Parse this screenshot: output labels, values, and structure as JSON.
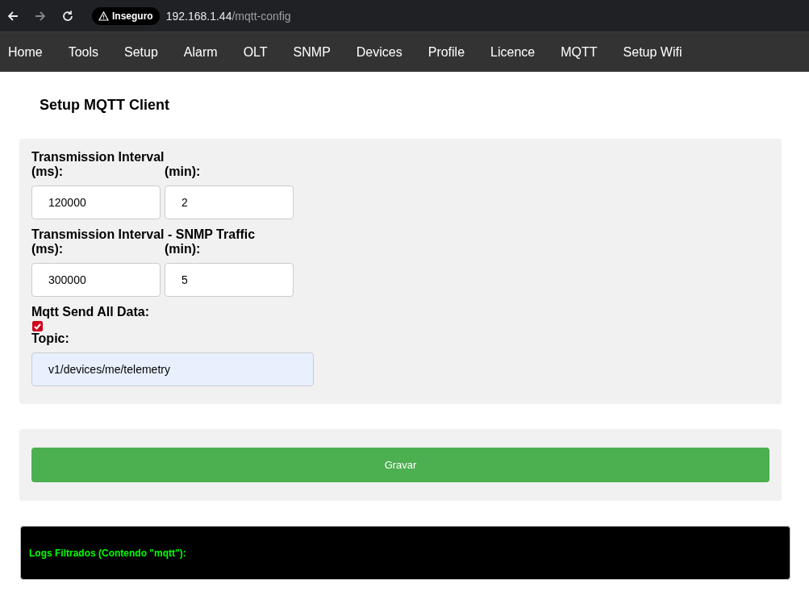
{
  "browser": {
    "security": "Inseguro",
    "url_host": "192.168.1.44",
    "url_path": "/mqtt-config"
  },
  "nav": [
    {
      "label": "Home"
    },
    {
      "label": "Tools"
    },
    {
      "label": "Setup"
    },
    {
      "label": "Alarm"
    },
    {
      "label": "OLT"
    },
    {
      "label": "SNMP"
    },
    {
      "label": "Devices"
    },
    {
      "label": "Profile"
    },
    {
      "label": "Licence"
    },
    {
      "label": "MQTT"
    },
    {
      "label": "Setup Wifi"
    }
  ],
  "title": "Setup MQTT Client",
  "interval_groups": [
    {
      "title": "Transmission Interval",
      "fields": [
        {
          "label": "(ms):",
          "value": "120000"
        },
        {
          "label": "(min):",
          "value": "2"
        }
      ]
    },
    {
      "title": "Transmission Interval - SNMP Traffic",
      "fields": [
        {
          "label": "(ms):",
          "value": "300000"
        },
        {
          "label": "(min):",
          "value": "5"
        }
      ]
    }
  ],
  "send_all": {
    "label": "Mqtt Send All Data:",
    "checked": true
  },
  "topic": {
    "label": "Topic:",
    "value": "v1/devices/me/telemetry"
  },
  "save_button": "Gravar",
  "logs": {
    "title": "Logs Filtrados (Contendo \"mqtt\"):"
  }
}
